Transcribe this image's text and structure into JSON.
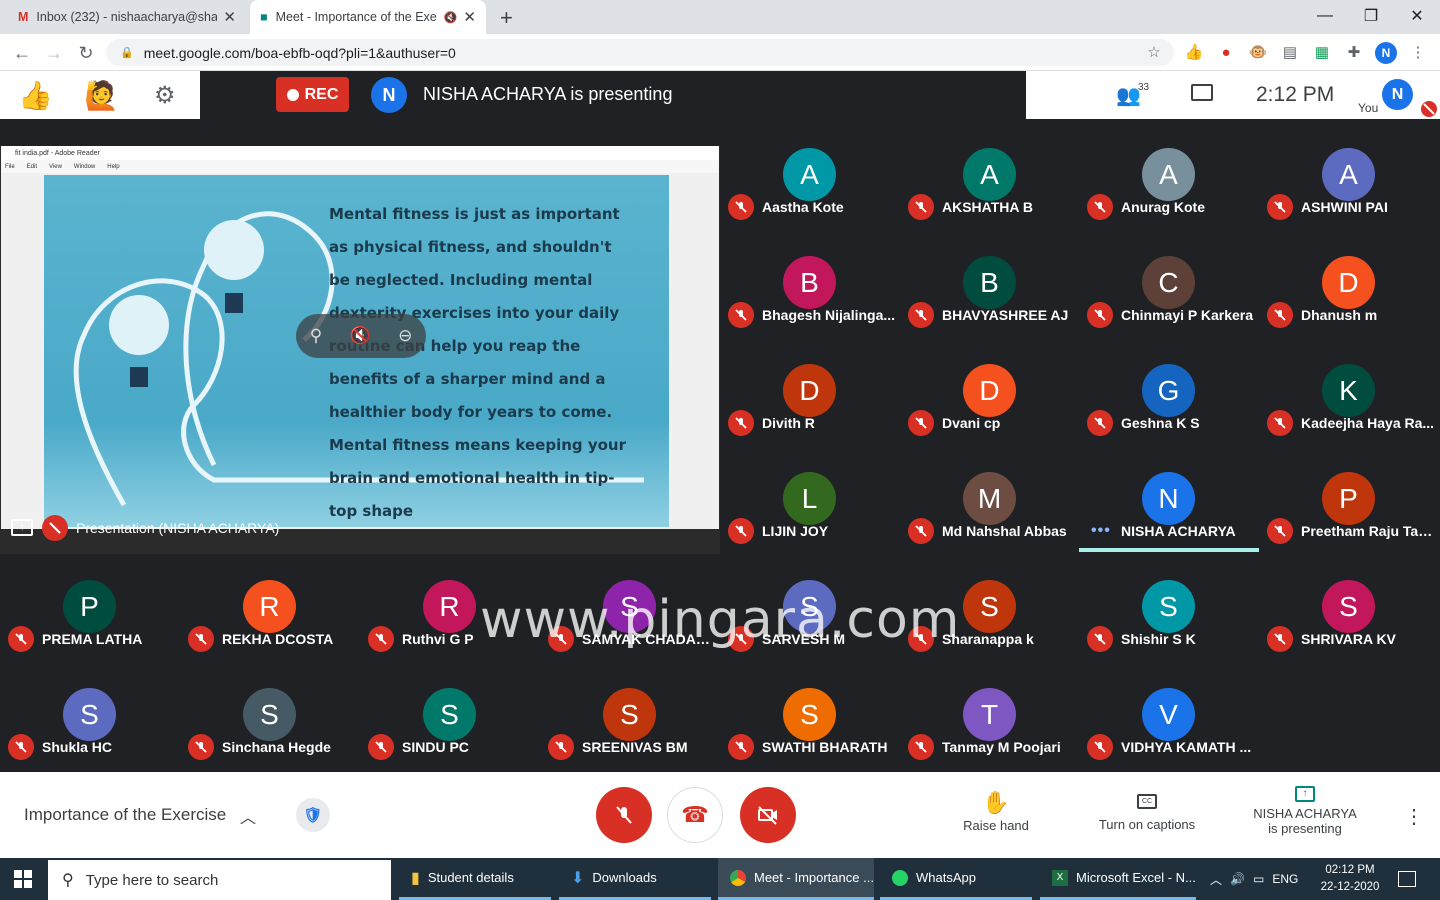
{
  "browser": {
    "tabs": [
      {
        "title": "Inbox (232) - nishaacharya@shak",
        "active": false
      },
      {
        "title": "Meet - Importance of the Exe",
        "active": true
      }
    ],
    "url": "meet.google.com/boa-ebfb-oqd?pli=1&authuser=0",
    "profile_initial": "N"
  },
  "meet": {
    "rec_label": "REC",
    "presenter_initial": "N",
    "presenting_text": "NISHA ACHARYA is presenting",
    "people_count": "33",
    "time": "2:12 PM",
    "self_label": "You",
    "self_initial": "N"
  },
  "presentation": {
    "reader_title": "fit india.pdf - Adobe Reader",
    "reader_menu": [
      "File",
      "Edit",
      "View",
      "Window",
      "Help"
    ],
    "slide_text": "Mental fitness is just as important as physical fitness, and shouldn't be neglected. Including mental dexterity exercises into your daily routine can help you reap the benefits of a sharper mind and a healthier body for years to come. Mental fitness means keeping your brain and emotional health in tip-top shape",
    "label": "Presentation (NISHA ACHARYA)"
  },
  "participants": [
    {
      "name": "Aastha Kote",
      "initial": "A",
      "color": "#0097a7"
    },
    {
      "name": "AKSHATHA B",
      "initial": "A",
      "color": "#00796b"
    },
    {
      "name": "Anurag Kote",
      "initial": "A",
      "color": "#78909c"
    },
    {
      "name": "ASHWINI PAI",
      "initial": "A",
      "color": "#5c6bc0"
    },
    {
      "name": "Bhagesh Nijalinga...",
      "initial": "B",
      "color": "#c2185b"
    },
    {
      "name": "BHAVYASHREE AJ",
      "initial": "B",
      "color": "#004d40"
    },
    {
      "name": "Chinmayi P Karkera",
      "initial": "C",
      "color": "#5d4037"
    },
    {
      "name": "Dhanush m",
      "initial": "D",
      "color": "#f4511e"
    },
    {
      "name": "Divith R",
      "initial": "D",
      "color": "#bf360c"
    },
    {
      "name": "Dvani cp",
      "initial": "D",
      "color": "#f4511e"
    },
    {
      "name": "Geshna K S",
      "initial": "G",
      "color": "#1565c0"
    },
    {
      "name": "Kadeejha Haya Ra...",
      "initial": "K",
      "color": "#004d40"
    },
    {
      "name": "LIJIN JOY",
      "initial": "L",
      "color": "#33691e"
    },
    {
      "name": "Md Nahshal Abbas",
      "initial": "M",
      "color": "#6d4c41"
    },
    {
      "name": "NISHA ACHARYA",
      "initial": "N",
      "color": "#1a73e8",
      "speaking": true
    },
    {
      "name": "Preetham Raju Tali...",
      "initial": "P",
      "color": "#bf360c"
    },
    {
      "name": "PREMA LATHA",
      "initial": "P",
      "color": "#004d40"
    },
    {
      "name": "REKHA DCOSTA",
      "initial": "R",
      "color": "#f4511e"
    },
    {
      "name": "Ruthvi G P",
      "initial": "R",
      "color": "#c2185b"
    },
    {
      "name": "SAMYAK CHADAGA",
      "initial": "S",
      "color": "#8e24aa"
    },
    {
      "name": "SARVESH M",
      "initial": "S",
      "color": "#5c6bc0"
    },
    {
      "name": "Sharanappa k",
      "initial": "S",
      "color": "#bf360c"
    },
    {
      "name": "Shishir S K",
      "initial": "S",
      "color": "#0097a7"
    },
    {
      "name": "SHRIVARA KV",
      "initial": "S",
      "color": "#c2185b"
    },
    {
      "name": "Shukla HC",
      "initial": "S",
      "color": "#5c6bc0"
    },
    {
      "name": "Sinchana Hegde",
      "initial": "S",
      "color": "#455a64"
    },
    {
      "name": "SINDU PC",
      "initial": "S",
      "color": "#00796b"
    },
    {
      "name": "SREENIVAS BM",
      "initial": "S",
      "color": "#bf360c"
    },
    {
      "name": "SWATHI BHARATH",
      "initial": "S",
      "color": "#ef6c00"
    },
    {
      "name": "Tanmay M Poojari",
      "initial": "T",
      "color": "#7e57c2"
    },
    {
      "name": "VIDHYA KAMATH ...",
      "initial": "V",
      "color": "#1a73e8"
    }
  ],
  "watermark": "www.pingara.com",
  "bottom": {
    "meeting_title": "Importance of the Exercise",
    "raise_hand": "Raise hand",
    "captions": "Turn on captions",
    "presenting_line1": "NISHA ACHARYA",
    "presenting_line2": "is presenting"
  },
  "taskbar": {
    "search_placeholder": "Type here to search",
    "items": [
      "Student details",
      "Downloads",
      "Meet - Importance ...",
      "WhatsApp",
      "Microsoft Excel - N..."
    ],
    "lang": "ENG",
    "time": "02:12 PM",
    "date": "22-12-2020"
  }
}
